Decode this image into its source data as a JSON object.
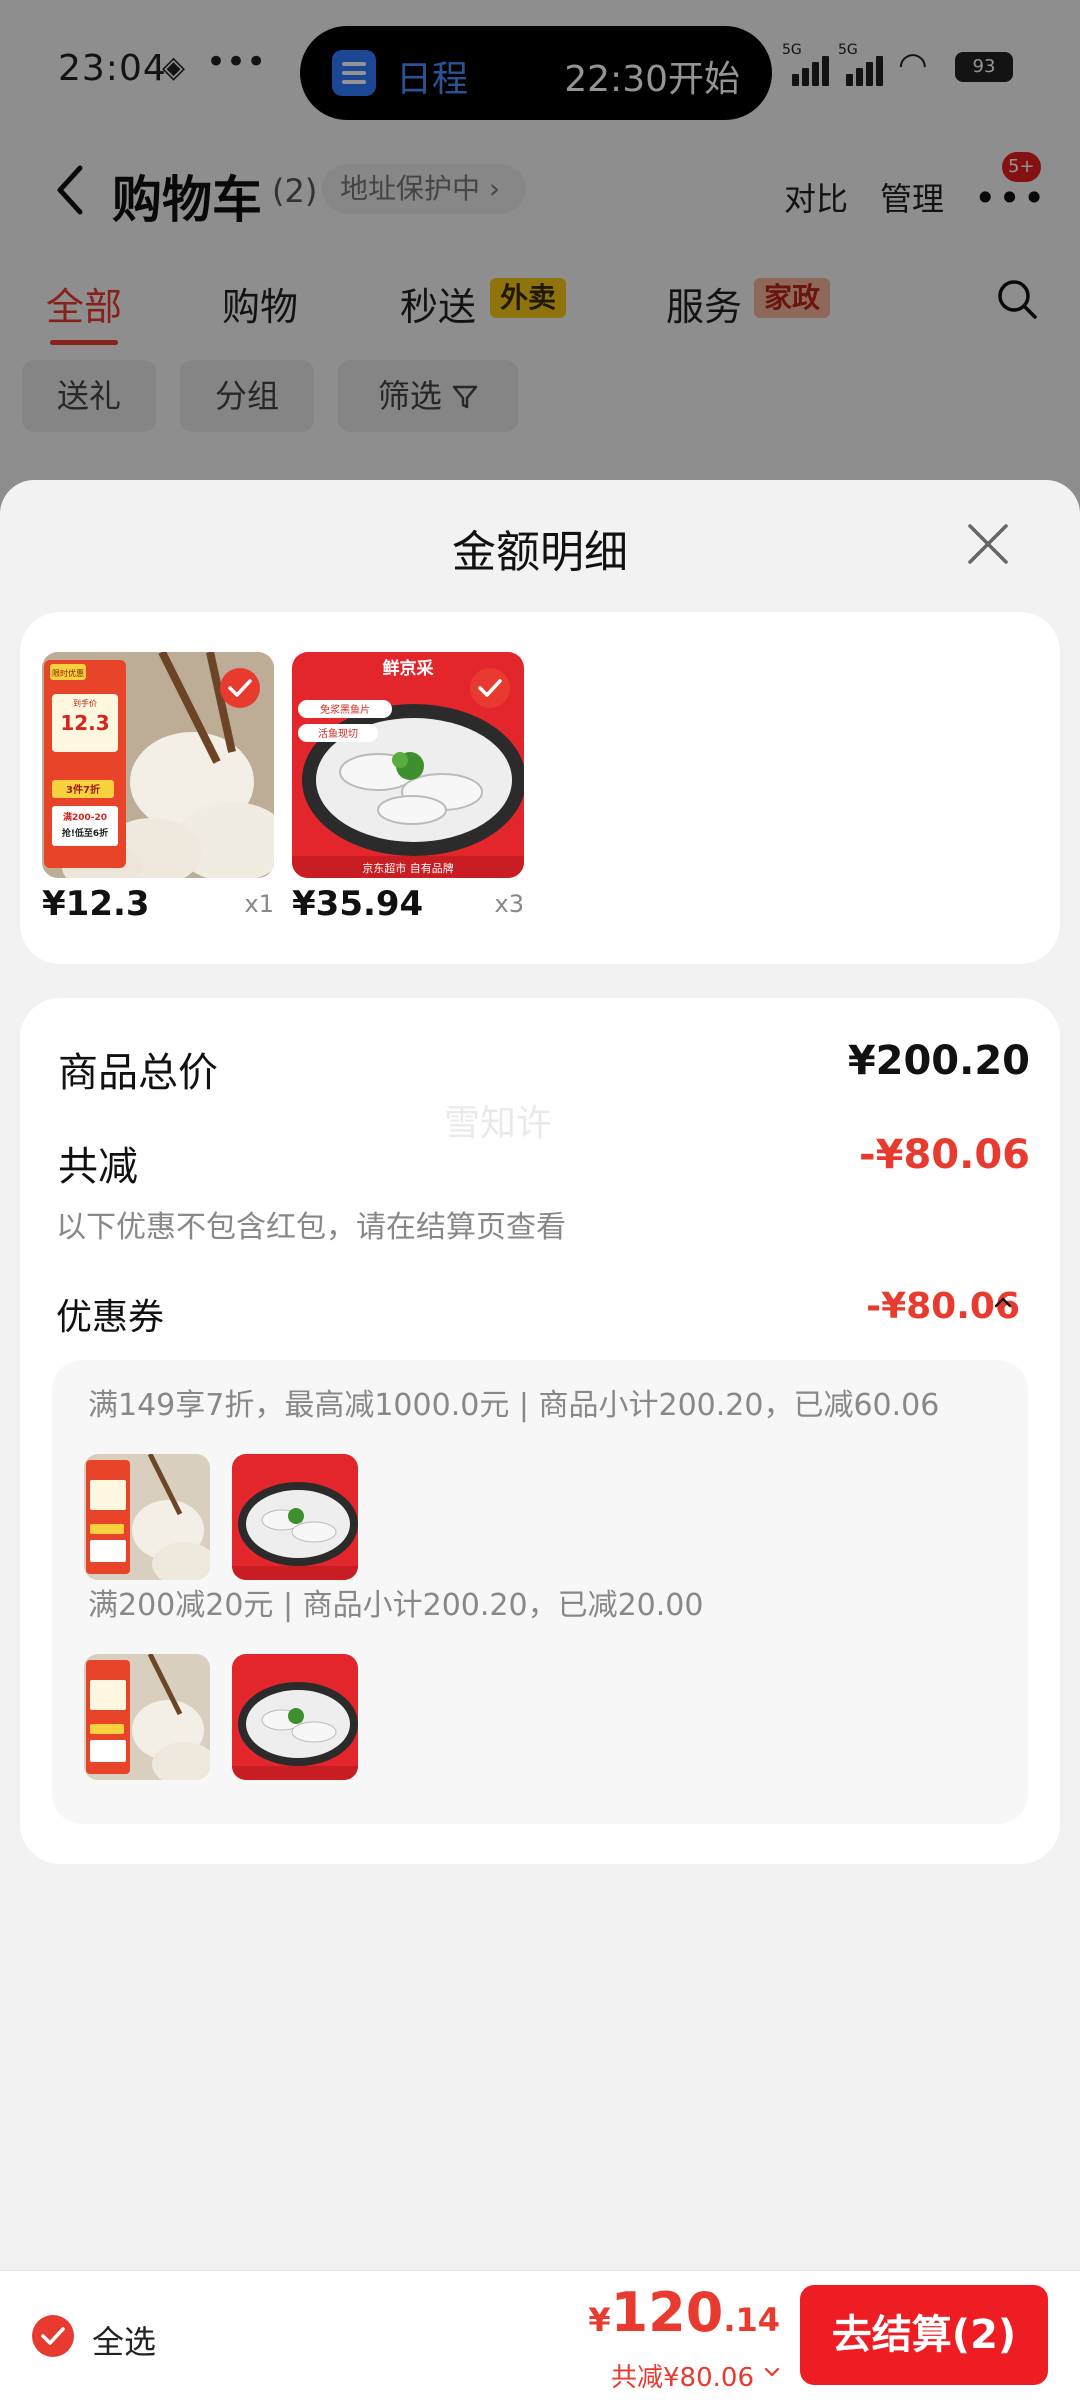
{
  "status_bar": {
    "time": "23:04",
    "island_app": "日程",
    "island_time": "22:30开始",
    "network_1": "5G",
    "network_2": "5G",
    "battery": "93"
  },
  "header": {
    "title": "购物车",
    "count": "(2)",
    "address": "地址保护中",
    "compare": "对比",
    "manage": "管理",
    "badge": "5+"
  },
  "tabs": [
    {
      "label": "全部",
      "active": true
    },
    {
      "label": "购物"
    },
    {
      "label": "秒送",
      "tag": "外卖"
    },
    {
      "label": "服务",
      "tag": "家政"
    }
  ],
  "chips": [
    "送礼",
    "分组",
    "筛选"
  ],
  "sheet": {
    "title": "金额明细",
    "items": [
      {
        "price": "¥12.3",
        "qty": "x1"
      },
      {
        "price": "¥35.94",
        "qty": "x3"
      }
    ],
    "watermark": "雪知许",
    "total_label": "商品总价",
    "total_value": "¥200.20",
    "discount_label": "共减",
    "discount_value": "-¥80.06",
    "discount_note": "以下优惠不包含红包，请在结算页查看",
    "coupon_label": "优惠券",
    "coupon_value": "-¥80.06",
    "rules": [
      {
        "text": "满149享7折，最高减1000.0元 | 商品小计200.20，已减60.06"
      },
      {
        "text": "满200减20元 | 商品小计200.20，已减20.00"
      }
    ]
  },
  "product_art": {
    "dumpling": {
      "logo": "限时优惠",
      "caption": "到手价",
      "price": "12.3",
      "deal": "3件7折",
      "coupon": "满200-20",
      "coupon_2": "抢!低至6折"
    },
    "fish": {
      "brand": "鲜京采",
      "tag1": "免浆黑鱼片",
      "tag2": "活鱼现切",
      "footer": "京东超市 自有品牌"
    }
  },
  "bottom": {
    "select_all": "全选",
    "currency": "¥",
    "total_int": "120",
    "total_dec": ".14",
    "saved": "共减¥80.06",
    "checkout": "去结算(2)"
  },
  "colors": {
    "accent": "#e83a2e",
    "checkout": "#ee1d23"
  }
}
